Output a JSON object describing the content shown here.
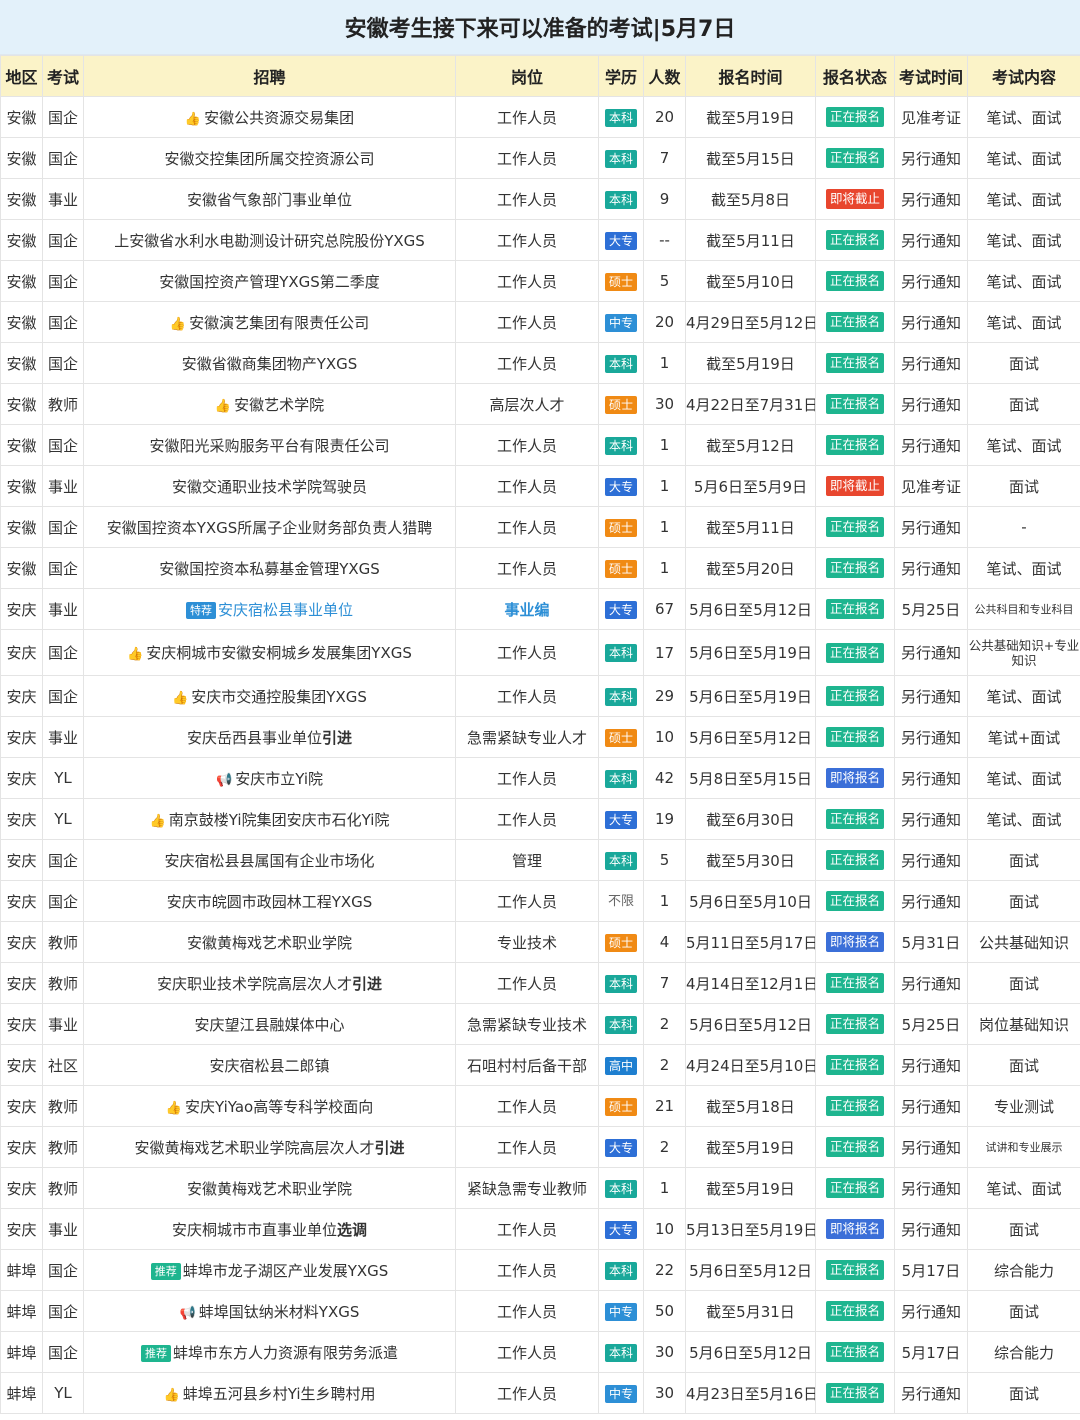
{
  "title": "安徽考生接下来可以准备的考试|5月7日",
  "headers": [
    "地区",
    "考试",
    "招聘",
    "岗位",
    "学历",
    "人数",
    "报名时间",
    "报名状态",
    "考试时间",
    "考试内容"
  ],
  "rows": [
    {
      "region": "安徽",
      "type": "国企",
      "icon": "thumb",
      "name": "安徽公共资源交易集团",
      "post": "工作人员",
      "edu": "本科",
      "num": "20",
      "date": "截至5月19日",
      "status": "正在报名",
      "exam_time": "见准考证",
      "content": "笔试、面试"
    },
    {
      "region": "安徽",
      "type": "国企",
      "name": "安徽交控集团所属交控资源公司",
      "post": "工作人员",
      "edu": "本科",
      "num": "7",
      "date": "截至5月15日",
      "status": "正在报名",
      "exam_time": "另行通知",
      "content": "笔试、面试"
    },
    {
      "region": "安徽",
      "type": "事业",
      "name": "安徽省气象部门事业单位",
      "post": "工作人员",
      "edu": "本科",
      "num": "9",
      "date": "截至5月8日",
      "status": "即将截止",
      "exam_time": "另行通知",
      "content": "笔试、面试"
    },
    {
      "region": "安徽",
      "type": "国企",
      "name": "上安徽省水利水电勘测设计研究总院股份YXGS",
      "post": "工作人员",
      "edu": "大专",
      "num": "--",
      "date": "截至5月11日",
      "status": "正在报名",
      "exam_time": "另行通知",
      "content": "笔试、面试"
    },
    {
      "region": "安徽",
      "type": "国企",
      "name": "安徽国控资产管理YXGS第二季度",
      "post": "工作人员",
      "edu": "硕士",
      "num": "5",
      "date": "截至5月10日",
      "status": "正在报名",
      "exam_time": "另行通知",
      "content": "笔试、面试"
    },
    {
      "region": "安徽",
      "type": "国企",
      "icon": "thumb",
      "name": "安徽演艺集团有限责任公司",
      "post": "工作人员",
      "edu": "中专",
      "num": "20",
      "date": "4月29日至5月12日",
      "status": "正在报名",
      "exam_time": "另行通知",
      "content": "笔试、面试"
    },
    {
      "region": "安徽",
      "type": "国企",
      "name": "安徽省徽商集团物产YXGS",
      "post": "工作人员",
      "edu": "本科",
      "num": "1",
      "date": "截至5月19日",
      "status": "正在报名",
      "exam_time": "另行通知",
      "content": "面试"
    },
    {
      "region": "安徽",
      "type": "教师",
      "icon": "thumb",
      "name": "安徽艺术学院",
      "post": "高层次人才",
      "edu": "硕士",
      "num": "30",
      "date": "4月22日至7月31日",
      "status": "正在报名",
      "exam_time": "另行通知",
      "content": "面试"
    },
    {
      "region": "安徽",
      "type": "国企",
      "name": "安徽阳光采购服务平台有限责任公司",
      "post": "工作人员",
      "edu": "本科",
      "num": "1",
      "date": "截至5月12日",
      "status": "正在报名",
      "exam_time": "另行通知",
      "content": "笔试、面试"
    },
    {
      "region": "安徽",
      "type": "事业",
      "name": "安徽交通职业技术学院驾驶员",
      "post": "工作人员",
      "edu": "大专",
      "num": "1",
      "date": "5月6日至5月9日",
      "status": "即将截止",
      "exam_time": "见准考证",
      "content": "面试"
    },
    {
      "region": "安徽",
      "type": "国企",
      "name": "安徽国控资本YXGS所属子企业财务部负责人猎聘",
      "post": "工作人员",
      "edu": "硕士",
      "num": "1",
      "date": "截至5月11日",
      "status": "正在报名",
      "exam_time": "另行通知",
      "content": "-"
    },
    {
      "region": "安徽",
      "type": "国企",
      "name": "安徽国控资本私募基金管理YXGS",
      "post": "工作人员",
      "edu": "硕士",
      "num": "1",
      "date": "截至5月20日",
      "status": "正在报名",
      "exam_time": "另行通知",
      "content": "笔试、面试"
    },
    {
      "region": "安庆",
      "type": "事业",
      "tag": "特荐",
      "name": "安庆宿松县事业单位",
      "name_style": "blue",
      "post": "事业编",
      "post_style": "bold-blue",
      "edu": "大专",
      "num": "67",
      "date": "5月6日至5月12日",
      "status": "正在报名",
      "exam_time": "5月25日",
      "content": "公共科目和专业科目",
      "content_style": "small"
    },
    {
      "region": "安庆",
      "type": "国企",
      "icon": "thumb",
      "name": "安庆桐城市安徽安桐城乡发展集团YXGS",
      "post": "工作人员",
      "edu": "本科",
      "num": "17",
      "date": "5月6日至5月19日",
      "status": "正在报名",
      "exam_time": "另行通知",
      "content": "公共基础知识+专业知识",
      "content_style": "twoline",
      "tall": true
    },
    {
      "region": "安庆",
      "type": "国企",
      "icon": "thumb",
      "name": "安庆市交通控股集团YXGS",
      "post": "工作人员",
      "edu": "本科",
      "num": "29",
      "date": "5月6日至5月19日",
      "status": "正在报名",
      "exam_time": "另行通知",
      "content": "笔试、面试"
    },
    {
      "region": "安庆",
      "type": "事业",
      "name": "安庆岳西县事业单位",
      "name_bold": "引进",
      "post": "急需紧缺专业人才",
      "edu": "硕士",
      "num": "10",
      "date": "5月6日至5月12日",
      "status": "正在报名",
      "exam_time": "另行通知",
      "content": "笔试+面试"
    },
    {
      "region": "安庆",
      "type": "YL",
      "icon": "horn",
      "name": "安庆市立Yi院",
      "post": "工作人员",
      "edu": "本科",
      "num": "42",
      "date": "5月8日至5月15日",
      "status": "即将报名",
      "exam_time": "另行通知",
      "content": "笔试、面试"
    },
    {
      "region": "安庆",
      "type": "YL",
      "icon": "thumb",
      "name": "南京鼓楼Yi院集团安庆市石化Yi院",
      "post": "工作人员",
      "edu": "大专",
      "num": "19",
      "date": "截至6月30日",
      "status": "正在报名",
      "exam_time": "另行通知",
      "content": "笔试、面试"
    },
    {
      "region": "安庆",
      "type": "国企",
      "name": "安庆宿松县县属国有企业市场化",
      "post": "管理",
      "edu": "本科",
      "num": "5",
      "date": "截至5月30日",
      "status": "正在报名",
      "exam_time": "另行通知",
      "content": "面试"
    },
    {
      "region": "安庆",
      "type": "国企",
      "name": "安庆市皖圆市政园林工程YXGS",
      "post": "工作人员",
      "edu": "不限",
      "num": "1",
      "date": "5月6日至5月10日",
      "status": "正在报名",
      "exam_time": "另行通知",
      "content": "面试"
    },
    {
      "region": "安庆",
      "type": "教师",
      "name": "安徽黄梅戏艺术职业学院",
      "post": "专业技术",
      "edu": "硕士",
      "num": "4",
      "date": "5月11日至5月17日",
      "status": "即将报名",
      "exam_time": "5月31日",
      "content": "公共基础知识"
    },
    {
      "region": "安庆",
      "type": "教师",
      "name": "安庆职业技术学院高层次人才",
      "name_bold": "引进",
      "post": "工作人员",
      "edu": "本科",
      "num": "7",
      "date": "4月14日至12月1日",
      "status": "正在报名",
      "exam_time": "另行通知",
      "content": "面试"
    },
    {
      "region": "安庆",
      "type": "事业",
      "name": "安庆望江县融媒体中心",
      "post": "急需紧缺专业技术",
      "edu": "本科",
      "num": "2",
      "date": "5月6日至5月12日",
      "status": "正在报名",
      "exam_time": "5月25日",
      "content": "岗位基础知识"
    },
    {
      "region": "安庆",
      "type": "社区",
      "name": "安庆宿松县二郎镇",
      "post": "石咀村村后备干部",
      "edu": "高中",
      "num": "2",
      "date": "4月24日至5月10日",
      "status": "正在报名",
      "exam_time": "另行通知",
      "content": "面试"
    },
    {
      "region": "安庆",
      "type": "教师",
      "icon": "thumb",
      "name": "安庆YiYao高等专科学校面向",
      "post": "工作人员",
      "edu": "硕士",
      "num": "21",
      "date": "截至5月18日",
      "status": "正在报名",
      "exam_time": "另行通知",
      "content": "专业测试"
    },
    {
      "region": "安庆",
      "type": "教师",
      "name": "安徽黄梅戏艺术职业学院高层次人才",
      "name_bold": "引进",
      "post": "工作人员",
      "edu": "大专",
      "num": "2",
      "date": "截至5月19日",
      "status": "正在报名",
      "exam_time": "另行通知",
      "content": "试讲和专业展示",
      "content_style": "small2"
    },
    {
      "region": "安庆",
      "type": "教师",
      "name": "安徽黄梅戏艺术职业学院",
      "post": "紧缺急需专业教师",
      "edu": "本科",
      "num": "1",
      "date": "截至5月19日",
      "status": "正在报名",
      "exam_time": "另行通知",
      "content": "笔试、面试"
    },
    {
      "region": "安庆",
      "type": "事业",
      "name": "安庆桐城市市直事业单位",
      "name_bold": "选调",
      "post": "工作人员",
      "edu": "大专",
      "num": "10",
      "date": "5月13日至5月19日",
      "status": "即将报名",
      "exam_time": "另行通知",
      "content": "面试"
    },
    {
      "region": "蚌埠",
      "type": "国企",
      "tag": "推荐",
      "name": "蚌埠市龙子湖区产业发展YXGS",
      "post": "工作人员",
      "edu": "本科",
      "num": "22",
      "date": "5月6日至5月12日",
      "status": "正在报名",
      "exam_time": "5月17日",
      "content": "综合能力"
    },
    {
      "region": "蚌埠",
      "type": "国企",
      "icon": "horn",
      "name": "蚌埠国钛纳米材料YXGS",
      "post": "工作人员",
      "edu": "中专",
      "num": "50",
      "date": "截至5月31日",
      "status": "正在报名",
      "exam_time": "另行通知",
      "content": "面试"
    },
    {
      "region": "蚌埠",
      "type": "国企",
      "tag": "推荐",
      "name": "蚌埠市东方人力资源有限劳务派遣",
      "post": "工作人员",
      "edu": "本科",
      "num": "30",
      "date": "5月6日至5月12日",
      "status": "正在报名",
      "exam_time": "5月17日",
      "content": "综合能力"
    },
    {
      "region": "蚌埠",
      "type": "YL",
      "icon": "thumb",
      "name": "蚌埠五河县乡村Yi生乡聘村用",
      "post": "工作人员",
      "edu": "中专",
      "num": "30",
      "date": "4月23日至5月16日",
      "status": "正在报名",
      "exam_time": "另行通知",
      "content": "面试"
    }
  ],
  "icons": {
    "thumb": "thumbs-up-icon",
    "horn": "megaphone-icon"
  },
  "colors": {
    "title_bg": "#e3f1fa",
    "header_bg": "#fbf3c8",
    "status_open": "#1eb58f",
    "status_closing": "#e8462e",
    "status_upcoming": "#3b6fd8"
  }
}
